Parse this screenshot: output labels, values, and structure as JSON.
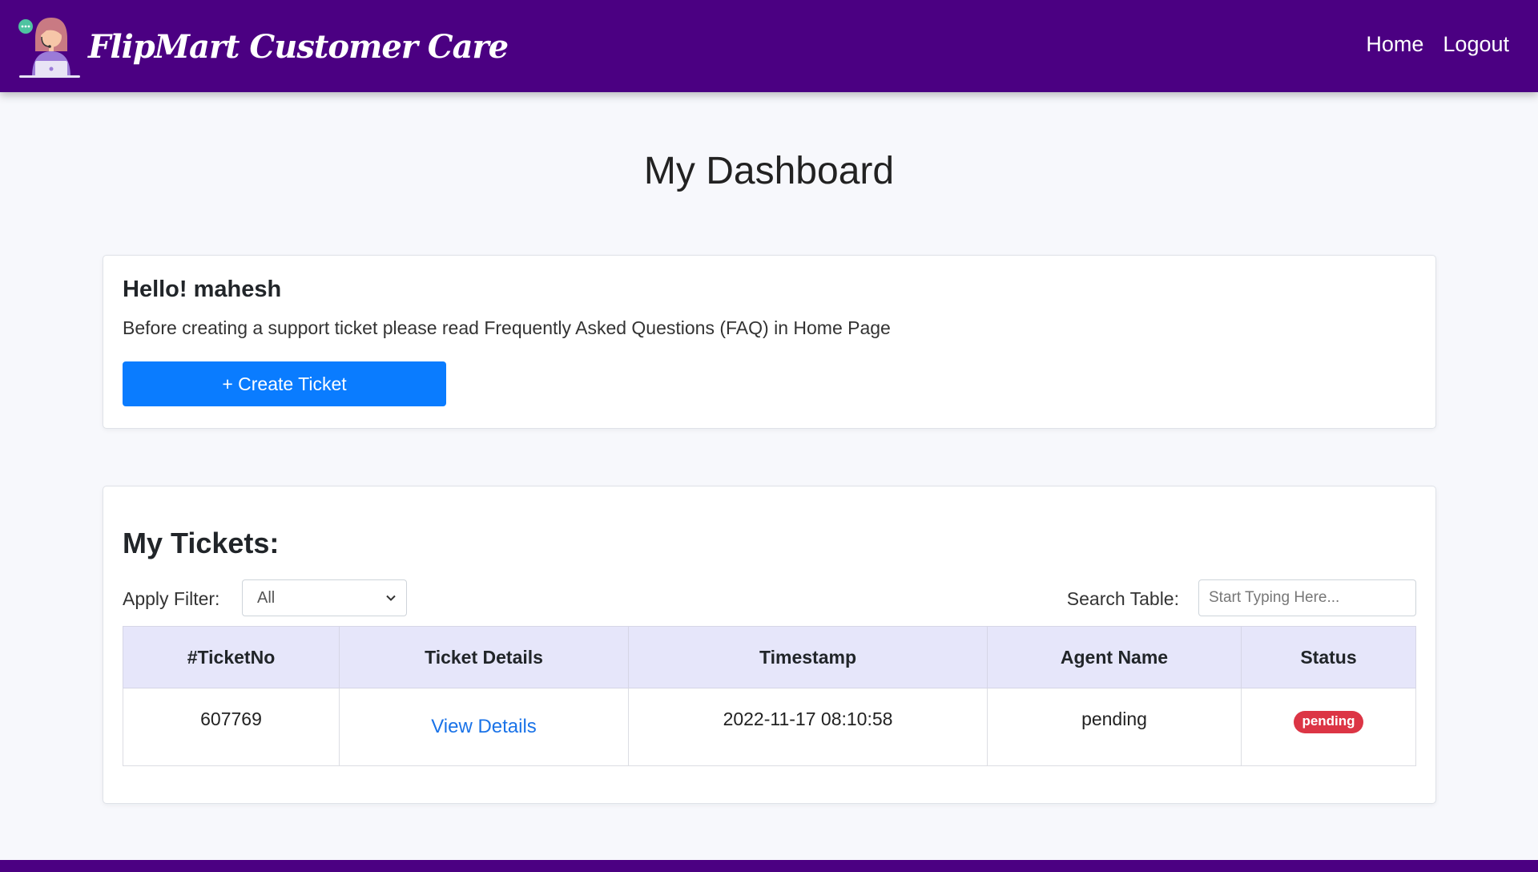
{
  "header": {
    "brand_name": "FlipMart Customer Care",
    "nav": [
      {
        "label": "Home"
      },
      {
        "label": "Logout"
      }
    ]
  },
  "main": {
    "page_title": "My Dashboard",
    "hello_card": {
      "greeting": "Hello! mahesh",
      "note": "Before creating a support ticket please read Frequently Asked Questions (FAQ) in Home Page",
      "create_button": "+ Create Ticket"
    },
    "tickets_card": {
      "title": "My Tickets:",
      "filter_label": "Apply Filter:",
      "filter_selected": "All",
      "search_label": "Search Table:",
      "search_placeholder": "Start Typing Here...",
      "search_value": "",
      "columns": [
        "#TicketNo",
        "Ticket Details",
        "Timestamp",
        "Agent Name",
        "Status"
      ],
      "rows": [
        {
          "ticket_no": "607769",
          "details_link": "View Details",
          "timestamp": "2022-11-17 08:10:58",
          "agent_name": "pending",
          "status": "pending"
        }
      ]
    }
  },
  "colors": {
    "navbar": "#4b0082",
    "primary_button": "#0a7cff",
    "table_header": "#e6e6fa",
    "status_pending": "#dc3545",
    "link": "#1a73e8"
  },
  "icons": {
    "logo": "support-agent-icon",
    "filter_dropdown": "chevron-down-icon"
  }
}
